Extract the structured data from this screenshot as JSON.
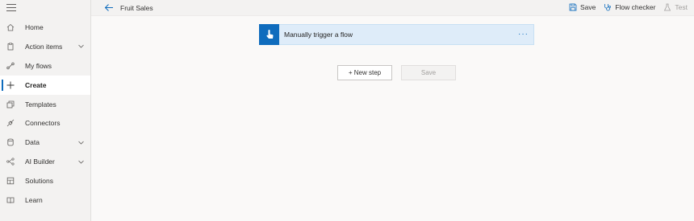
{
  "sidebar": {
    "items": [
      {
        "label": "Home",
        "icon": "home-icon",
        "chevron": false,
        "active": false
      },
      {
        "label": "Action items",
        "icon": "clipboard-icon",
        "chevron": true,
        "active": false
      },
      {
        "label": "My flows",
        "icon": "flow-icon",
        "chevron": false,
        "active": false
      },
      {
        "label": "Create",
        "icon": "plus-icon",
        "chevron": false,
        "active": true
      },
      {
        "label": "Templates",
        "icon": "templates-icon",
        "chevron": false,
        "active": false
      },
      {
        "label": "Connectors",
        "icon": "connector-icon",
        "chevron": false,
        "active": false
      },
      {
        "label": "Data",
        "icon": "database-icon",
        "chevron": true,
        "active": false
      },
      {
        "label": "AI Builder",
        "icon": "ai-builder-icon",
        "chevron": true,
        "active": false
      },
      {
        "label": "Solutions",
        "icon": "solutions-icon",
        "chevron": false,
        "active": false
      },
      {
        "label": "Learn",
        "icon": "book-icon",
        "chevron": false,
        "active": false
      }
    ]
  },
  "header": {
    "title": "Fruit Sales",
    "actions": {
      "save": "Save",
      "flow_checker": "Flow checker",
      "test": "Test"
    }
  },
  "canvas": {
    "trigger": {
      "label": "Manually trigger a flow",
      "menu": "···"
    },
    "new_step": "+ New step",
    "save": "Save"
  },
  "colors": {
    "accent": "#0f6cbd",
    "trigger_bg": "#deecf9",
    "sidebar_bg": "#f3f2f1"
  }
}
